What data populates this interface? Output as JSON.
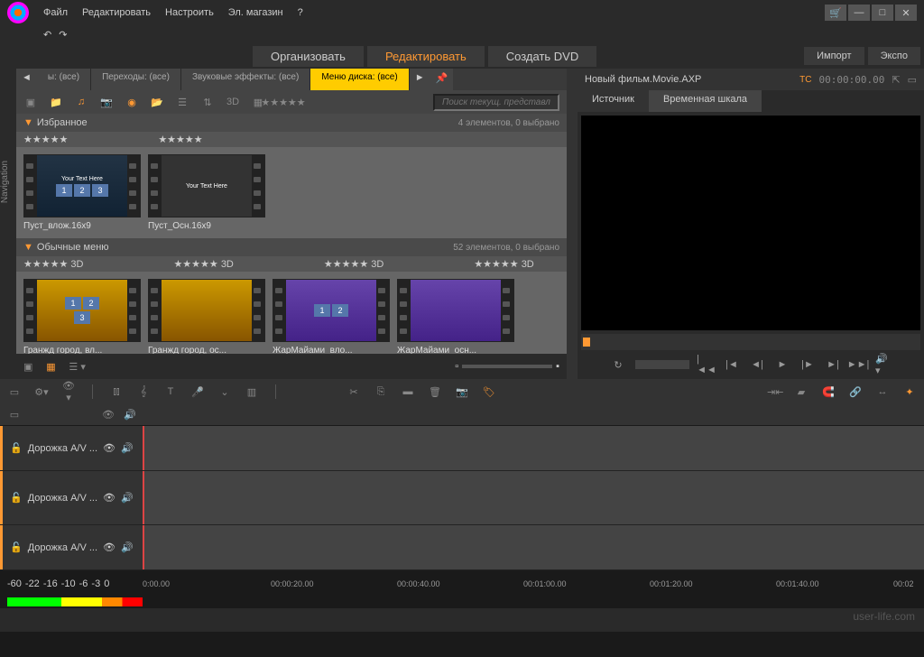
{
  "menu": {
    "file": "Файл",
    "edit": "Редактировать",
    "setup": "Настроить",
    "store": "Эл. магазин"
  },
  "mainTabs": {
    "organize": "Организовать",
    "edit": "Редактировать",
    "dvd": "Создать DVD"
  },
  "sideButtons": {
    "import": "Импорт",
    "export": "Экспо"
  },
  "browserTabs": {
    "all": "ы: (все)",
    "transitions": "Переходы: (все)",
    "sounds": "Звуковые эффекты: (все)",
    "menu": "Меню диска: (все)"
  },
  "search": {
    "placeholder": "Поиск текущ. представл"
  },
  "sections": {
    "fav": {
      "title": "Избранное",
      "info": "4 элементов, 0 выбрано"
    },
    "regular": {
      "title": "Обычные меню",
      "info": "52 элементов, 0 выбрано"
    }
  },
  "rating3d": "3D",
  "thumbs": {
    "fav": [
      {
        "label": "Пуст_влож.16x9",
        "text": "Your Text Here"
      },
      {
        "label": "Пуст_Осн.16x9",
        "text": "Your Text Here"
      }
    ],
    "regular": [
      {
        "label": "Гранжд город, вл...",
        "style": "yellow"
      },
      {
        "label": "Гранжд город, ос...",
        "style": "yellow"
      },
      {
        "label": "ЖарМайами_вло...",
        "style": "purple"
      },
      {
        "label": "ЖарМайами_осн...",
        "style": "purple"
      }
    ]
  },
  "navLabel": "Navigation",
  "preview": {
    "title": "Новый фильм.Movie.AXP",
    "tcLabel": "TC",
    "tc": "00:00:00.00",
    "tabs": {
      "source": "Источник",
      "timeline": "Временная шкала"
    }
  },
  "tracks": {
    "av": "Дорожка A/V ..."
  },
  "ruler": {
    "marks": [
      "-60",
      "-22",
      "-16",
      "-10",
      "-6",
      "-3",
      "0"
    ],
    "times": [
      "0:00.00",
      "00:00:20.00",
      "00:00:40.00",
      "00:01:00.00",
      "00:01:20.00",
      "00:01:40.00",
      "00:02"
    ]
  },
  "watermark": "user-life.com"
}
